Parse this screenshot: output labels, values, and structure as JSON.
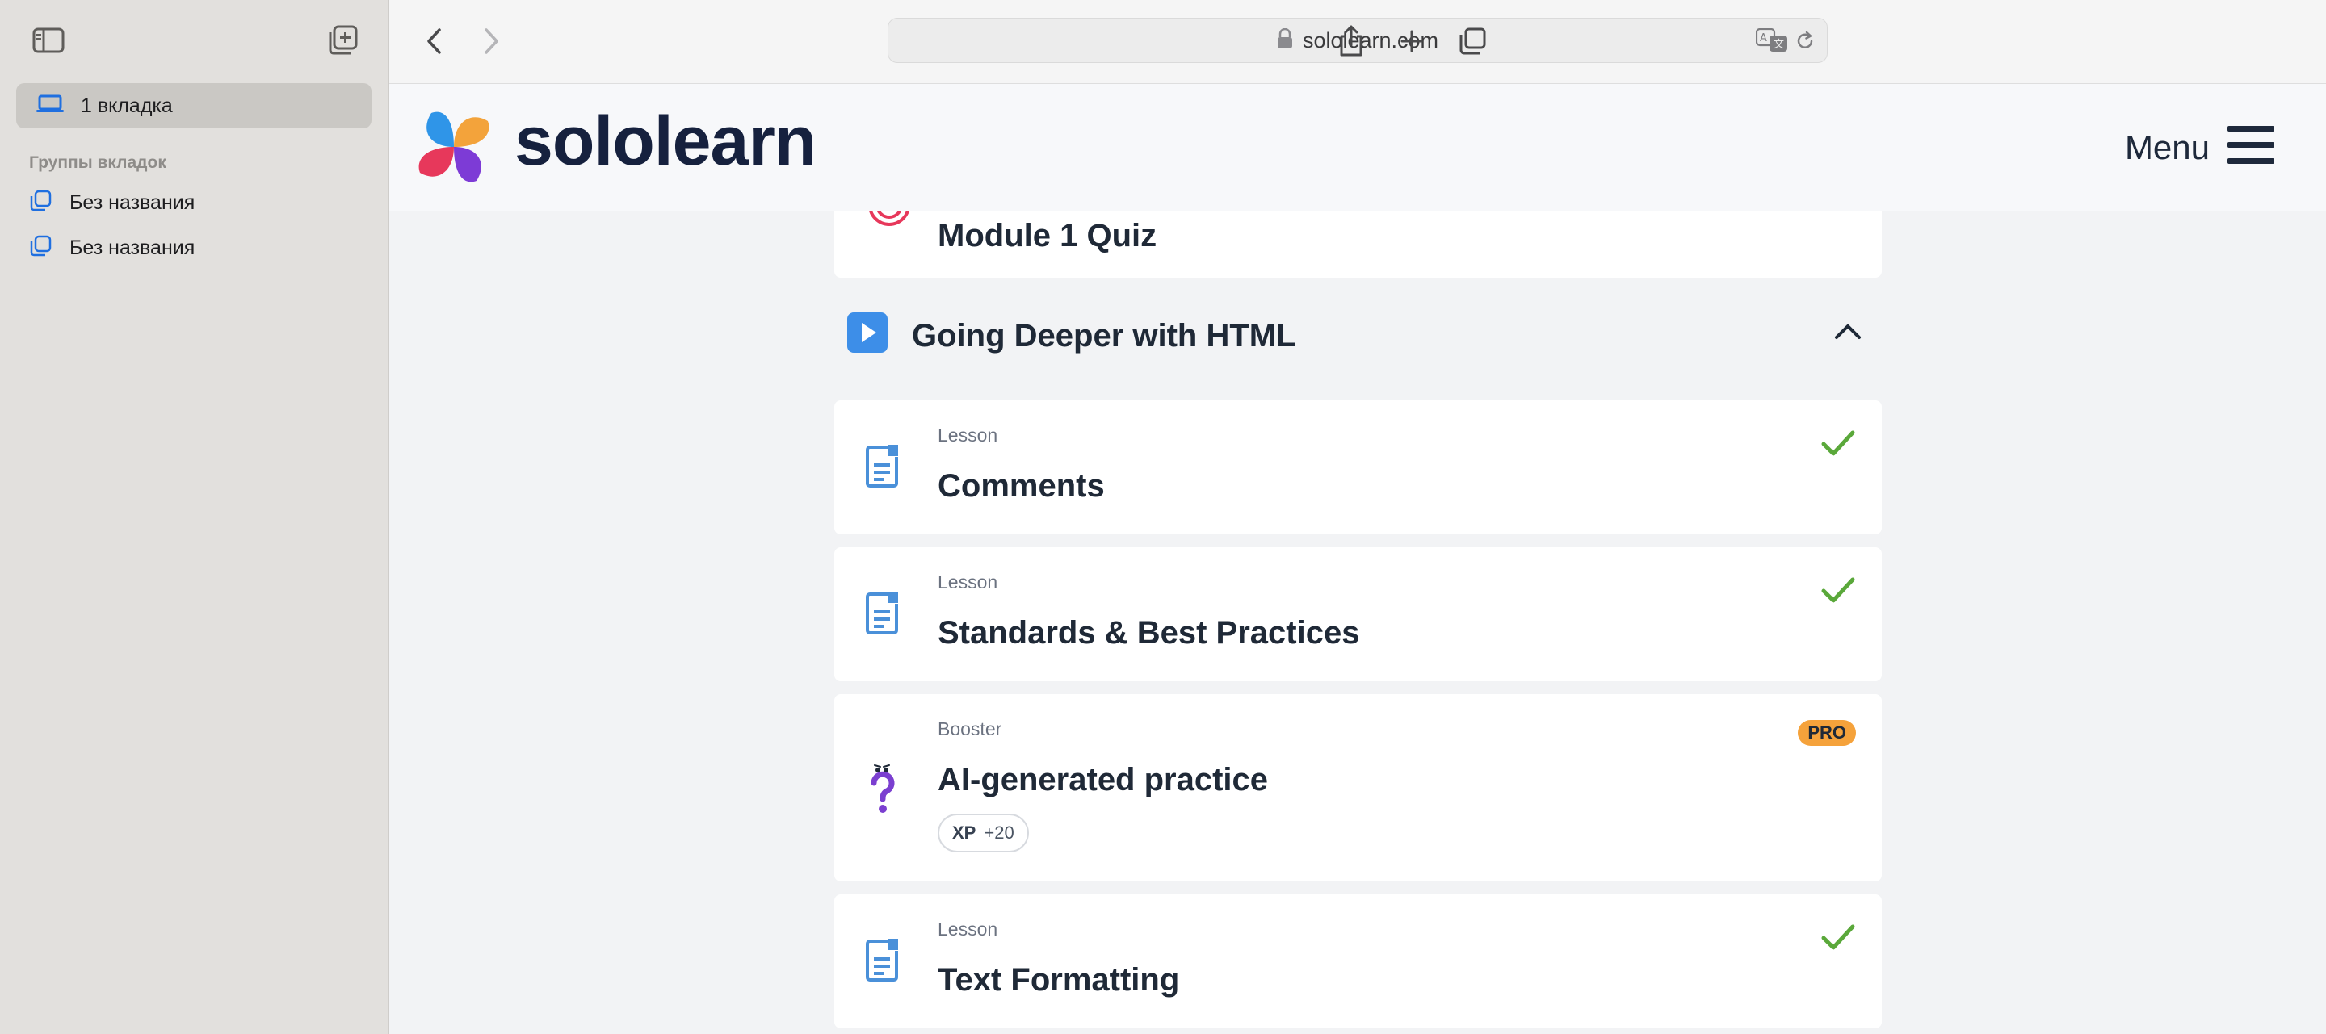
{
  "sidebar": {
    "active_tab": "1 вкладка",
    "groups_heading": "Группы вкладок",
    "groups": [
      "Без названия",
      "Без названия"
    ]
  },
  "toolbar": {
    "url": "sololearn.com"
  },
  "site": {
    "logo_text": "sololearn",
    "menu_label": "Menu"
  },
  "course": {
    "quiz_title": "Module 1 Quiz",
    "module_title": "Going Deeper with HTML",
    "items": [
      {
        "kind": "Lesson",
        "title": "Comments",
        "completed": true
      },
      {
        "kind": "Lesson",
        "title": "Standards & Best Practices",
        "completed": true
      },
      {
        "kind": "Booster",
        "title": "AI-generated practice",
        "badge": "PRO",
        "xp_label": "XP",
        "xp_value": "+20"
      },
      {
        "kind": "Lesson",
        "title": "Text Formatting",
        "completed": true
      }
    ]
  },
  "colors": {
    "lesson_icon": "#4a90d9",
    "check": "#5aa83a",
    "pro_badge": "#f5a23b",
    "module_play": "#3d8ee8",
    "booster_icon": "#7b3fd0"
  }
}
